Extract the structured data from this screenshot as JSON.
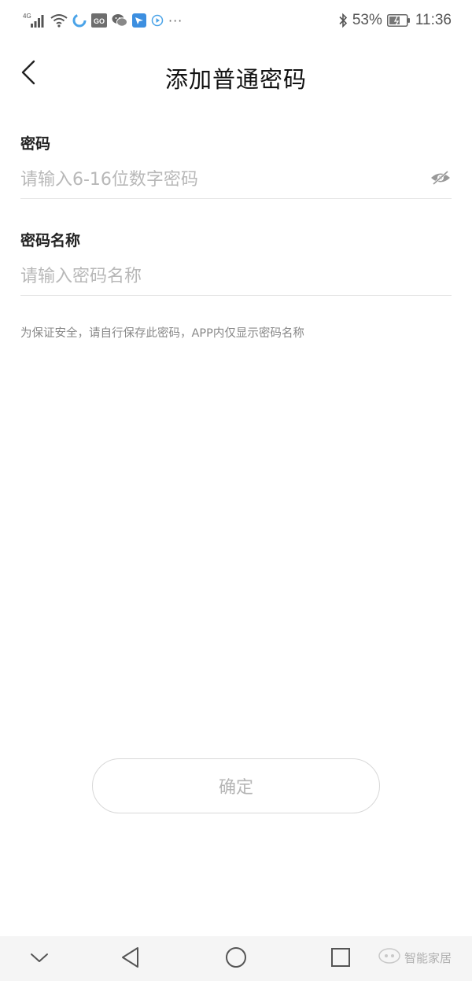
{
  "status_bar": {
    "network": "4G",
    "battery_percent": "53%",
    "time": "11:36",
    "app_badge": "GO",
    "more": "···",
    "icons": [
      "signal-icon",
      "wifi-icon",
      "sync-icon",
      "go-app-icon",
      "wechat-icon",
      "feishu-icon",
      "play-icon",
      "bluetooth-icon",
      "battery-icon"
    ]
  },
  "header": {
    "title": "添加普通密码"
  },
  "form": {
    "password": {
      "label": "密码",
      "placeholder": "请输入6-16位数字密码",
      "value": ""
    },
    "password_name": {
      "label": "密码名称",
      "placeholder": "请输入密码名称",
      "value": ""
    },
    "hint": "为保证安全，请自行保存此密码，APP内仅显示密码名称"
  },
  "confirm_button": {
    "label": "确定"
  },
  "nav_bar": {
    "icons": [
      "hide-keyboard-icon",
      "back-triangle-icon",
      "home-circle-icon",
      "recents-square-icon"
    ]
  },
  "watermark": {
    "text": "智能家居"
  },
  "colors": {
    "background": "#ffffff",
    "placeholder": "#b8b8b8",
    "hint": "#888888",
    "disabled_button_text": "#b5b5b5",
    "nav_bar_bg": "#f5f5f5"
  }
}
